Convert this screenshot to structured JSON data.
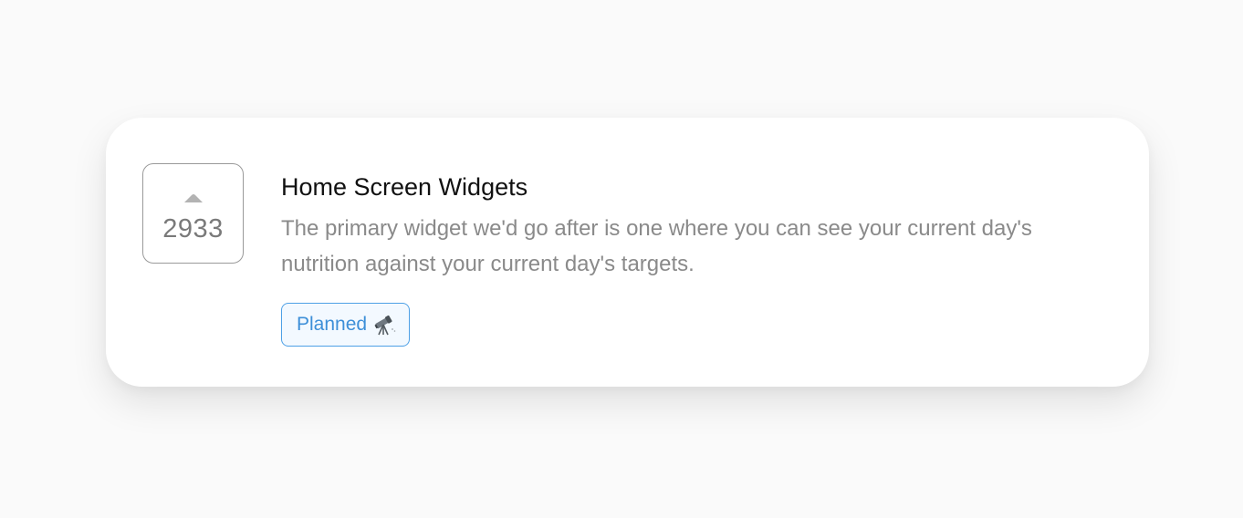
{
  "card": {
    "vote_count": "2933",
    "title": "Home Screen Widgets",
    "description": "The primary widget we'd go after is one where you can see your current day's nutrition against your current day's targets.",
    "status_label": "Planned",
    "status_icon": "telescope-icon"
  },
  "colors": {
    "background": "#fafafa",
    "card": "#ffffff",
    "title": "#111111",
    "description": "#8a8a8a",
    "vote_border": "#9a9a9a",
    "vote_arrow": "#b3b3b3",
    "badge_border": "#4ea0e6",
    "badge_text": "#3d8fd8"
  }
}
